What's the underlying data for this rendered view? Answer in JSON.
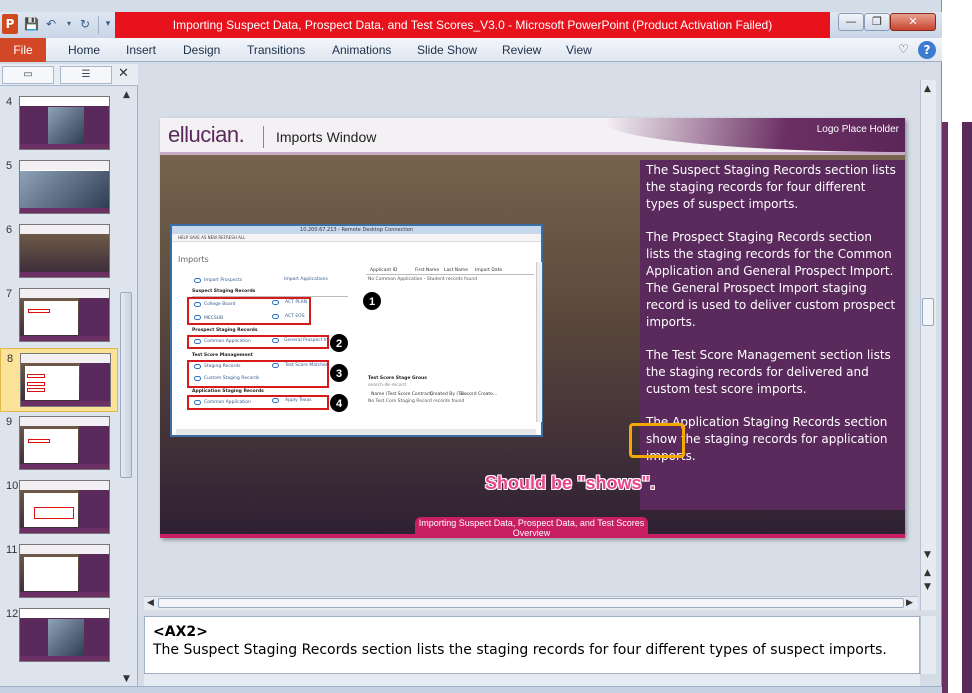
{
  "window": {
    "title": "Importing Suspect Data, Prospect Data, and Test Scores_V3.0  -  Microsoft PowerPoint (Product Activation Failed)",
    "app_icon": "P",
    "controls": [
      "minimize-icon",
      "restore-icon",
      "close-icon"
    ]
  },
  "ribbon": {
    "file_tab": "File",
    "tabs": [
      "Home",
      "Insert",
      "Design",
      "Transitions",
      "Animations",
      "Slide Show",
      "Review",
      "View"
    ]
  },
  "thumbnails": {
    "numbers": [
      "4",
      "5",
      "6",
      "7",
      "8",
      "9",
      "10",
      "11",
      "12"
    ],
    "selected": "8"
  },
  "slide": {
    "brand": "ellucian.",
    "title": "Imports Window",
    "logo_placeholder": "Logo Place Holder",
    "panel_paragraphs": [
      "The Suspect Staging Records section lists the staging records for four different types of suspect imports.",
      "The Prospect Staging Records section lists the staging records for the Common Application and General Prospect Import. The General Prospect Import staging record is used to deliver custom prospect imports.",
      "The Test Score Management section lists the staging records for delivered  and custom test score imports.",
      "The Application Staging Records section show the staging records for application imports."
    ],
    "review_comment": "Should be \"shows\".",
    "footer": "Importing Suspect Data, Prospect Data, and Test Scores Overview",
    "colors": {
      "purple": "#5b2a5d",
      "footer": "#c81f62",
      "highlight": "#f2a900",
      "comment": "#e8478b"
    }
  },
  "screenshot": {
    "title": "10.200.67.213 - Remote Desktop Connection",
    "toolbar": "HELP   SAVE AS   NEW   REFRESH ALL",
    "heading": "Imports",
    "import_prospects": "Import Prospects",
    "import_applications": "Import Applications",
    "suspect_section": "Suspect Staging Records",
    "college_board": "College Board",
    "act_plan": "ACT PLAN",
    "mecsub": "MECSUB",
    "act_eos": "ACT EOS",
    "prospect_section": "Prospect Staging Records",
    "common_application": "Common Application",
    "general_prospect_import": "General Prospect Import",
    "test_section": "Test Score Management",
    "staging_records": "Staging Records",
    "test_score_matcher": "Test Score Matcher",
    "custom_staging_records": "Custom Staging Records",
    "application_section": "Application Staging Records",
    "common_app_2": "Common Application",
    "apply_texas": "Apply Texas",
    "grid_headers": [
      "Applicant ID",
      "First Name",
      "Last Name",
      "Import Date"
    ],
    "grid_empty": "No Common Application - Student records found",
    "grid2_title": "Test Score Stage Grous",
    "grid2_search": "search-dk-record",
    "grid2_headers": [
      "Name (Test Score Contract)",
      "Created By (Tu...",
      "Record Create..."
    ],
    "grid2_empty": "No Test Core Staging Record records found",
    "badges": [
      "1",
      "2",
      "3",
      "4"
    ]
  },
  "notes": {
    "tag": "<AX2>",
    "text": "The Suspect Staging Records section lists the staging records for four different types of suspect imports."
  }
}
